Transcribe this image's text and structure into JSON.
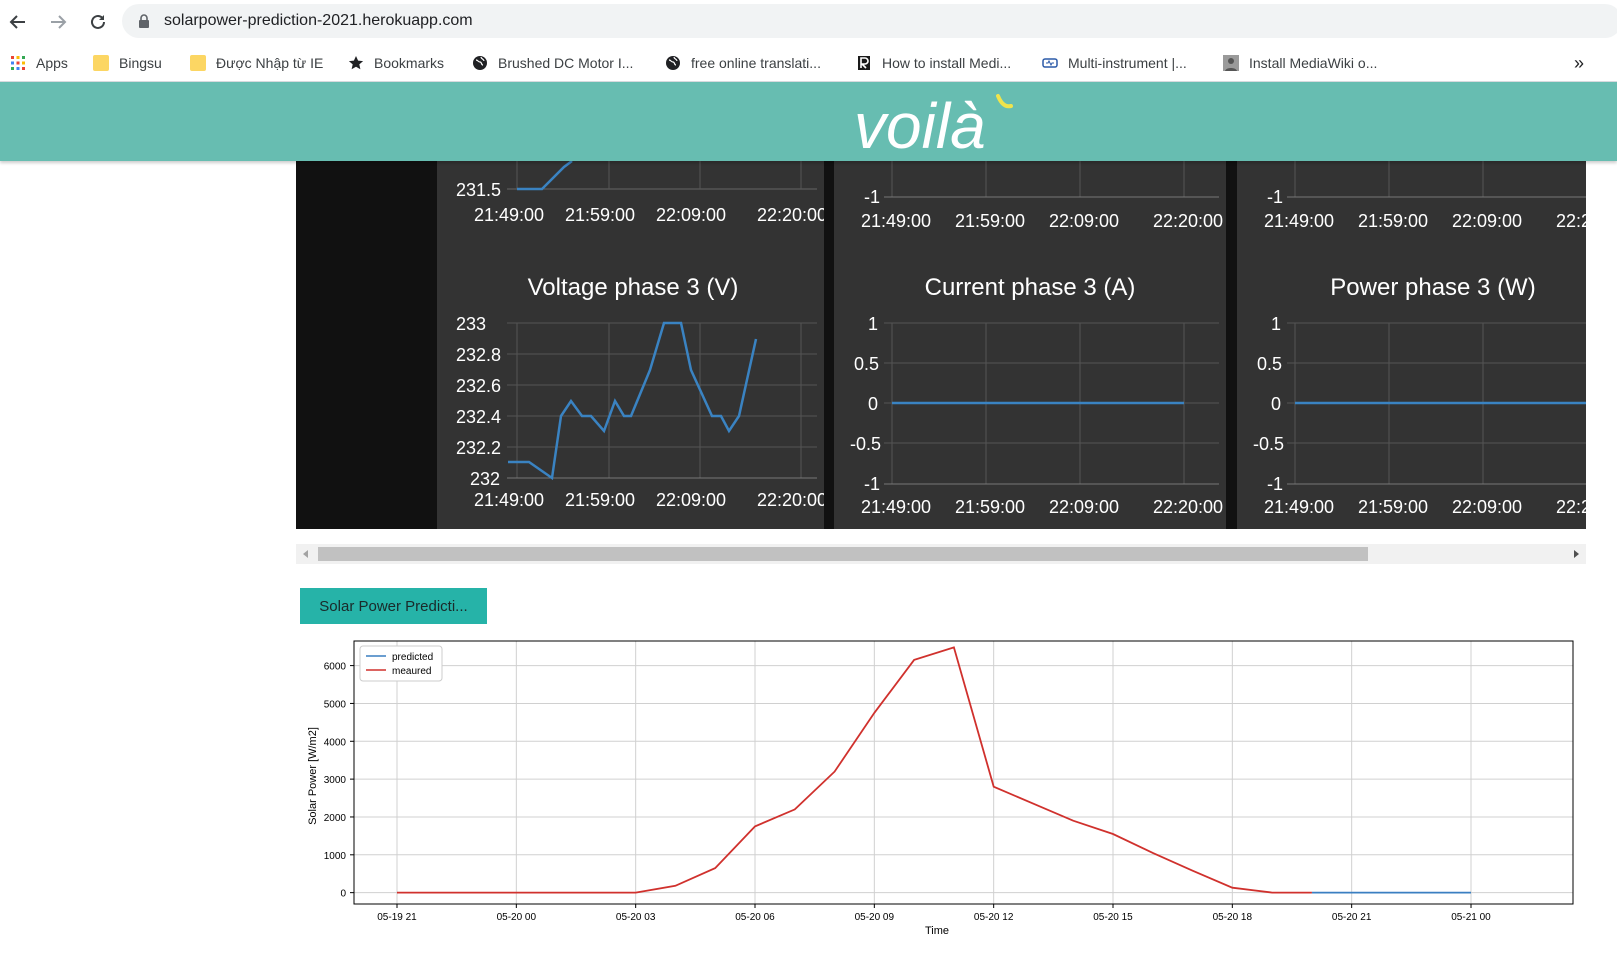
{
  "browser": {
    "url": "solarpower-prediction-2021.herokuapp.com",
    "bookmarks": [
      {
        "label": "Apps",
        "icon": "apps-grid-icon"
      },
      {
        "label": "Bingsu",
        "icon": "folder-icon"
      },
      {
        "label": "Được Nhập từ IE",
        "icon": "folder-icon"
      },
      {
        "label": "Bookmarks",
        "icon": "star-icon"
      },
      {
        "label": "Brushed DC Motor I...",
        "icon": "globe-icon"
      },
      {
        "label": "free online translati...",
        "icon": "globe-icon"
      },
      {
        "label": "How to install Medi...",
        "icon": "r-logo-icon"
      },
      {
        "label": "Multi-instrument |...",
        "icon": "multi-instrument-icon"
      },
      {
        "label": "Install MediaWiki o...",
        "icon": "avatar-icon"
      }
    ],
    "more": "»"
  },
  "header": {
    "logo": "voilà"
  },
  "dashboard": {
    "times": [
      "21:49:00",
      "21:59:00",
      "22:09:00",
      "22:20:00"
    ],
    "top_row": {
      "left_tick": "231.5",
      "mid_tick": "-1",
      "right_tick": "-1"
    },
    "panels": [
      {
        "title": "Voltage phase 3 (V)",
        "yticks": [
          "233",
          "232.8",
          "232.6",
          "232.4",
          "232.2",
          "232"
        ]
      },
      {
        "title": "Current phase 3 (A)",
        "yticks": [
          "1",
          "0.5",
          "0",
          "-0.5",
          "-1"
        ]
      },
      {
        "title": "Power phase 3 (W)",
        "yticks": [
          "1",
          "0.5",
          "0",
          "-0.5",
          "-1"
        ]
      }
    ],
    "line_color": "#3a83c2"
  },
  "prediction_button": "Solar Power Predicti...",
  "chart_data": {
    "type": "line",
    "xlabel": "Time",
    "ylabel": "Solar Power [W/m2]",
    "x_ticks": [
      "05-19 21",
      "05-20 00",
      "05-20 03",
      "05-20 06",
      "05-20 09",
      "05-20 12",
      "05-20 15",
      "05-20 18",
      "05-20 21",
      "05-21 00"
    ],
    "y_ticks": [
      "0",
      "1000",
      "2000",
      "3000",
      "4000",
      "5000",
      "6000"
    ],
    "ylim": [
      -300,
      6650
    ],
    "grid": true,
    "legend_position": "top-left",
    "series": [
      {
        "name": "predicted",
        "color": "#3a7fc1",
        "x": [
          "05-20 20",
          "05-20 21",
          "05-20 22",
          "05-20 23",
          "05-21 00"
        ],
        "values": [
          0,
          0,
          0,
          0,
          0
        ]
      },
      {
        "name": "meaured",
        "color": "#d0312d",
        "x": [
          "05-19 21",
          "05-19 22",
          "05-19 23",
          "05-20 00",
          "05-20 01",
          "05-20 02",
          "05-20 03",
          "05-20 04",
          "05-20 05",
          "05-20 06",
          "05-20 07",
          "05-20 08",
          "05-20 09",
          "05-20 10",
          "05-20 11",
          "05-20 12",
          "05-20 13",
          "05-20 14",
          "05-20 15",
          "05-20 16",
          "05-20 17",
          "05-20 18",
          "05-20 19",
          "05-20 20"
        ],
        "values": [
          0,
          0,
          0,
          0,
          0,
          0,
          0,
          180,
          650,
          1750,
          2200,
          3200,
          4750,
          6150,
          6480,
          2800,
          2350,
          1900,
          1550,
          1050,
          580,
          130,
          0,
          0
        ]
      }
    ]
  }
}
